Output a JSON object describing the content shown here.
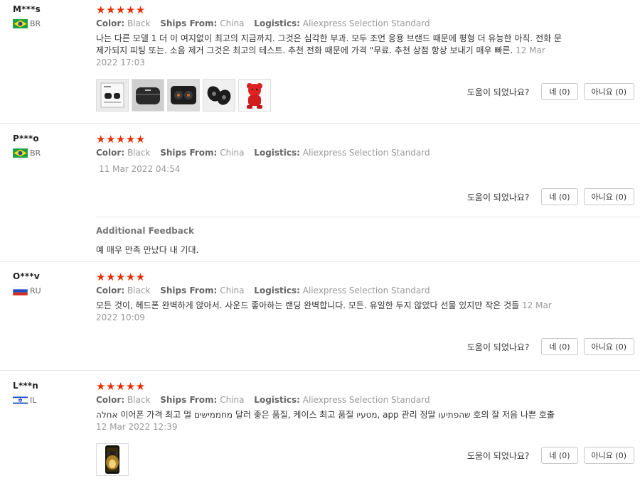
{
  "helpful_question": "도움이 되었나요?",
  "labels": {
    "color": "Color:",
    "ships_from": "Ships From:",
    "logistics": "Logistics:"
  },
  "reviews": [
    {
      "name": "M***s",
      "country": "BR",
      "flag": "brazil",
      "stars": "★★★★★",
      "color": "Black",
      "ships_from": "China",
      "logistics": "Aliexpress Selection Standard",
      "text": "나는 다른 모델 1 더 이 여지없이 최고의 지금까지. 그것은 심각한 부과. 모두 조언 응용 브랜드 때문에 평형 더 유능한 아직. 전화 문제가되지 피팅 또는. 소음 제거 그것은 최고의 테스트. 추천 전화 때문에 가격 \"무료. 추천 상점 항상 보내기 매우 빠른.",
      "date": "12 Mar 2022 17:03",
      "yes": "네 (0)",
      "no": "아니요 (0)"
    },
    {
      "name": "P***o",
      "country": "BR",
      "flag": "brazil",
      "stars": "★★★★★",
      "color": "Black",
      "ships_from": "China",
      "logistics": "Aliexpress Selection Standard",
      "date": "11 Mar 2022 04:54",
      "yes": "네 (0)",
      "no": "아니요 (0)",
      "additional_title": "Additional Feedback",
      "additional_text": "예 매우 만족 만났다 내 기대."
    },
    {
      "name": "O***v",
      "country": "RU",
      "flag": "russia",
      "stars": "★★★★★",
      "color": "Black",
      "ships_from": "China",
      "logistics": "Aliexpress Selection Standard",
      "text": "모든 것이, 헤드폰 완벽하게 앉아서. 사운드 좋아하는 랜딩 완벽합니다. 모든. 유일한 두지 않았다 선물 있지만 작은 것들",
      "date": "12 Mar 2022 10:09",
      "yes": "네 (0)",
      "no": "아니요 (0)"
    },
    {
      "name": "L***n",
      "country": "IL",
      "flag": "israel",
      "stars": "★★★★★",
      "color": "Black",
      "ships_from": "China",
      "logistics": "Aliexpress Selection Standard",
      "text": "אחלה 이어폰 가격 최고 멀 מחממישים 달러 좋은 품질, 케이스 최고 품질 מטעיו, app 관리 정말 שהפתיעו 호의 잘 저음 나쁜 호출",
      "date": "12 Mar 2022 12:39",
      "yes": "네 (0)",
      "no": "아니요 (0)"
    }
  ]
}
